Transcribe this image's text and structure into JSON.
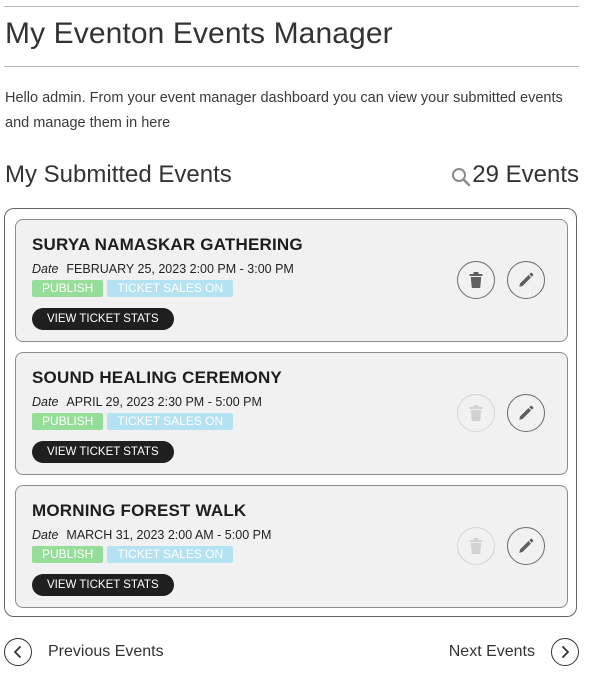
{
  "page": {
    "title": "My Eventon Events Manager",
    "intro": "Hello admin. From your event manager dashboard you can view your submitted events and manage them in here"
  },
  "submitted": {
    "title": "My Submitted Events",
    "count_label": "29 Events",
    "search_icon": "search-icon"
  },
  "events": [
    {
      "title": "SURYA NAMASKAR GATHERING",
      "date_label": "Date",
      "date": "FEBRUARY 25, 2023 2:00 PM - 3:00 PM",
      "status": "PUBLISH",
      "tickets": "TICKET SALES ON",
      "stats_label": "VIEW TICKET STATS",
      "delete_enabled": true
    },
    {
      "title": "SOUND HEALING CEREMONY",
      "date_label": "Date",
      "date": "APRIL 29, 2023 2:30 PM - 5:00 PM",
      "status": "PUBLISH",
      "tickets": "TICKET SALES ON",
      "stats_label": "VIEW TICKET STATS",
      "delete_enabled": false
    },
    {
      "title": "MORNING FOREST WALK",
      "date_label": "Date",
      "date": "MARCH 31, 2023 2:00 AM - 5:00 PM",
      "status": "PUBLISH",
      "tickets": "TICKET SALES ON",
      "stats_label": "VIEW TICKET STATS",
      "delete_enabled": false
    }
  ],
  "pagination": {
    "prev_label": "Previous Events",
    "next_label": "Next Events"
  },
  "colors": {
    "publish": "#96dd9a",
    "ticket_sales": "#b4e2f2",
    "stats_button": "#1f1f1f",
    "card_background": "#f1f1f1"
  }
}
